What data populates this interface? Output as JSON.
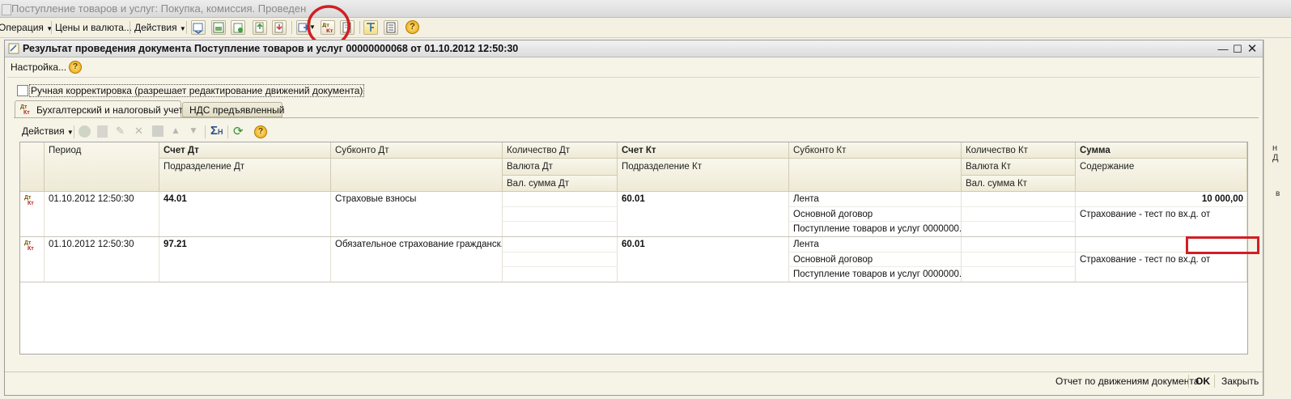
{
  "outer_window": {
    "title": "Поступление товаров и услуг: Покупка, комиссия. Проведен",
    "toolbar": {
      "operation_label": "Операция",
      "prices_label": "Цены и валюта...",
      "actions_label": "Действия"
    }
  },
  "inner_window": {
    "title": "Результат проведения документа Поступление товаров и услуг 00000000068 от 01.10.2012 12:50:30",
    "settings_label": "Настройка...",
    "manual_checkbox_label": "Ручная корректировка (разрешает редактирование движений документа)",
    "tabs": [
      {
        "label": "Бухгалтерский и налоговый учет",
        "active": true
      },
      {
        "label": "НДС предъявленный",
        "active": false
      }
    ],
    "grid_toolbar": {
      "actions_label": "Действия"
    },
    "columns": {
      "period": "Период",
      "account_dt": "Счет Дт",
      "division_dt": "Подразделение Дт",
      "subconto_dt": "Субконто Дт",
      "quantity_dt": "Количество Дт",
      "currency_dt": "Валюта Дт",
      "cur_sum_dt": "Вал. сумма Дт",
      "account_kt": "Счет Кт",
      "division_kt": "Подразделение Кт",
      "subconto_kt": "Субконто Кт",
      "quantity_kt": "Количество Кт",
      "currency_kt": "Валюта Кт",
      "cur_sum_kt": "Вал. сумма Кт",
      "sum": "Сумма",
      "content": "Содержание"
    },
    "rows": [
      {
        "period": "01.10.2012 12:50:30",
        "account_dt": "44.01",
        "subconto_dt": "Страховые взносы",
        "account_kt": "60.01",
        "subconto_kt": [
          "Лента",
          "Основной договор",
          "Поступление товаров и услуг 0000000..."
        ],
        "sum": "10 000,00",
        "content": "Страхование - тест по вх.д. от"
      },
      {
        "period": "01.10.2012 12:50:30",
        "account_dt": "97.21",
        "subconto_dt": "Обязательное страхование гражданск...",
        "account_kt": "60.01",
        "subconto_kt": [
          "Лента",
          "Основной договор",
          "Поступление товаров и услуг 0000000..."
        ],
        "sum": "",
        "content": "Страхование - тест по вх.д. от"
      }
    ],
    "status_bar": {
      "report_label": "Отчет по движениям документа",
      "ok_label": "OK",
      "close_label": "Закрыть"
    }
  },
  "colors": {
    "highlight_circle": "#d11f24",
    "highlight_rect": "#d11f24",
    "panel_bg": "#f6f3e7"
  }
}
